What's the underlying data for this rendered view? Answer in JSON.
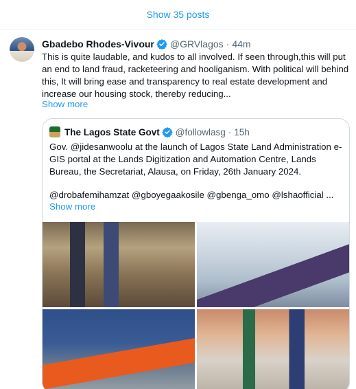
{
  "timeline": {
    "show_posts_label": "Show 35 posts"
  },
  "tweet": {
    "author_name": "Gbadebo Rhodes-Vivour",
    "author_handle": "@GRVlagos",
    "separator": "·",
    "time": "44m",
    "text": "This is quite laudable, and kudos to all involved. If seen through,this will put an end to land fraud, racketeering and hooliganism. With political will behind this, It will bring ease and transparency to real estate development and increase our housing stock, thereby reducing...",
    "show_more_label": "Show more",
    "verified_icon": "verified-badge-icon",
    "accent_color": "#1d9bf0"
  },
  "quote": {
    "author_name": "The Lagos State Govt",
    "author_handle": "@followlasg",
    "separator": "·",
    "time": "15h",
    "text": "Gov. @jidesanwoolu at the launch of  Lagos State Land Administration e-GIS portal at the Lands Digitization and Automation Centre, Lands Bureau, the Secretariat, Alausa, on Friday, 26th January 2024.",
    "mentions": "@drobafemihamzat @gboyegaakosile @gbenga_omo @lshaofficial ...",
    "show_more_label": "Show more"
  }
}
